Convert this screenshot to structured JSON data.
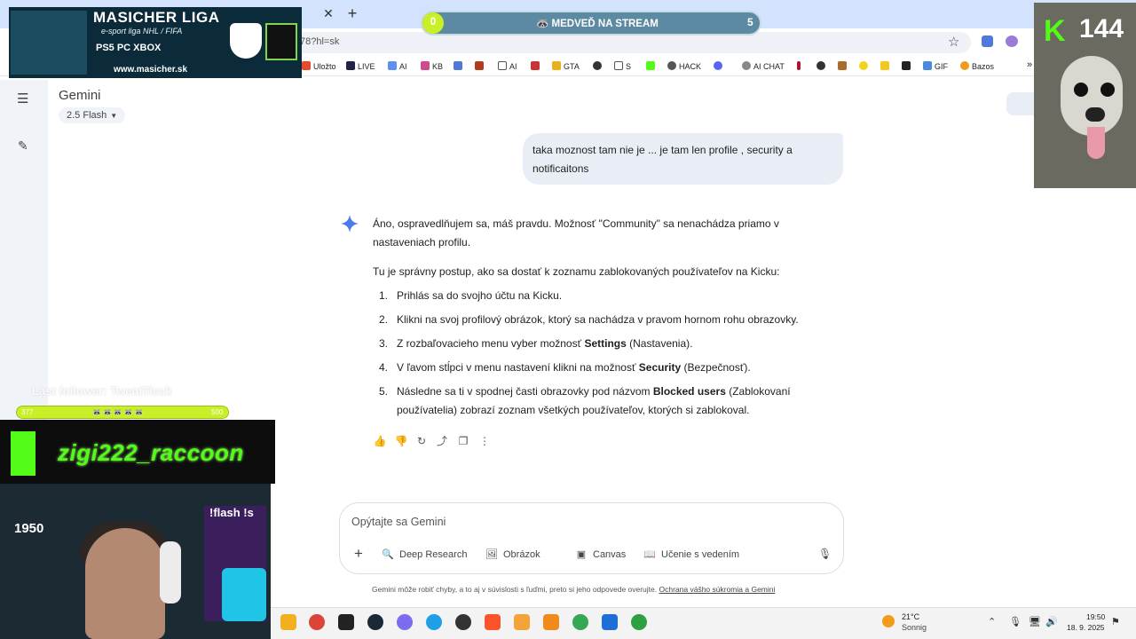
{
  "browser": {
    "url": "78?hl=sk",
    "bookmarks": [
      "Uložto",
      "LIVE",
      "AI",
      "KB",
      "AI",
      "GTA",
      "S",
      "HACK",
      "AI CHAT",
      "GIF",
      "Bazos"
    ]
  },
  "app": {
    "title": "Gemini",
    "model": "2.5 Flash"
  },
  "chat": {
    "user_message": "taka moznost tam nie je ... je tam len profile , security a notificaitons",
    "response": {
      "intro": "Áno, ospravedlňujem sa, máš pravdu. Možnosť \"Community\" sa nenachádza priamo v nastaveniach profilu.",
      "lead": "Tu je správny postup, ako sa dostať k zoznamu zablokovaných používateľov na Kicku:",
      "steps": [
        {
          "num": "1.",
          "before": "Prihlás sa do svojho účtu na Kicku.",
          "bold": "",
          "after": ""
        },
        {
          "num": "2.",
          "before": "Klikni na svoj profilový obrázok, ktorý sa nachádza v pravom hornom rohu obrazovky.",
          "bold": "",
          "after": ""
        },
        {
          "num": "3.",
          "before": "Z rozbaľovacieho menu vyber možnosť ",
          "bold": "Settings",
          "after": " (Nastavenia)."
        },
        {
          "num": "4.",
          "before": "V ľavom stĺpci v menu nastavení klikni na možnosť ",
          "bold": "Security",
          "after": " (Bezpečnosť)."
        },
        {
          "num": "5.",
          "before": "Následne sa ti v spodnej časti obrazovky pod názvom ",
          "bold": "Blocked users",
          "after": " (Zablokovaní používatelia) zobrazí zoznam všetkých používateľov, ktorých si zablokoval."
        }
      ]
    }
  },
  "composer": {
    "placeholder": "Opýtajte sa Gemini",
    "tools": [
      "Deep Research",
      "Obrázok",
      "Canvas",
      "Učenie s vedením"
    ]
  },
  "disclaimer": {
    "text": "Gemini môže robiť chyby, a to aj v súvislosti s ľuďmi, preto si jeho odpovede overujte.",
    "link": "Ochrana vášho súkromia a Gemini"
  },
  "overlay": {
    "banner_title": "MASICHER LIGA",
    "banner_sub": "e-sport liga NHL / FIFA",
    "banner_consoles": "PS5   PC   XBOX",
    "banner_web": "www.masicher.sk",
    "goal_left": "0",
    "goal_title": "🦝 MEDVEĎ NA STREAM",
    "goal_right": "5",
    "kick_logo": "K",
    "viewer_count": "144",
    "follower_text": "Last follower: TwentTicck",
    "follow_goal_left": "377",
    "follow_goal_icons": "🦝🦝🦝🦝🦝",
    "follow_goal_right": "500",
    "streamer_name": "zigi222_raccoon",
    "cam_sign": "!flash !s",
    "cam_number": "1950"
  },
  "taskbar": {
    "temperature": "21°C",
    "weather": "Sonnig",
    "time": "19:50",
    "date": "18. 9. 2025"
  },
  "colors": {
    "kick_green": "#53fc18",
    "bubble": "#e9eef6",
    "sidebar": "#f0f4f9"
  }
}
